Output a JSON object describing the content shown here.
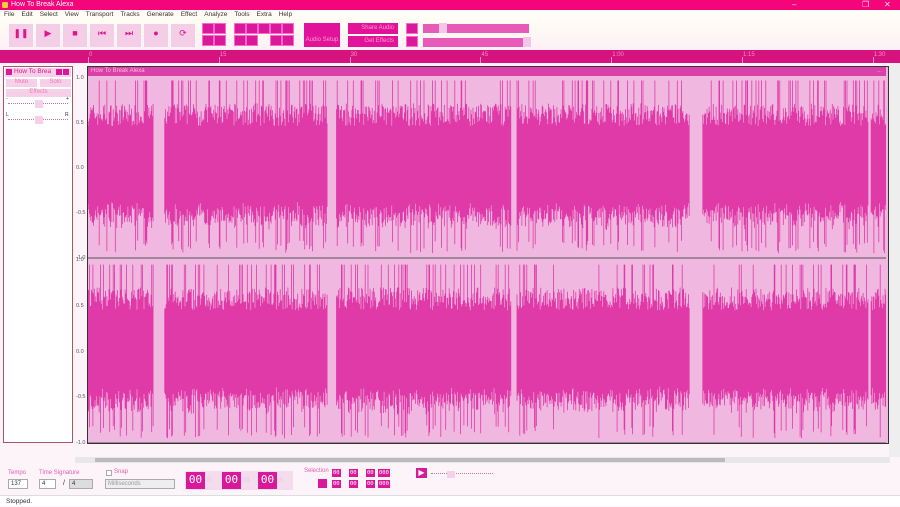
{
  "window": {
    "title": "How To Break Alexa",
    "minimize": "–",
    "restore": "❐",
    "close": "✕"
  },
  "menu": [
    "File",
    "Edit",
    "Select",
    "View",
    "Transport",
    "Tracks",
    "Generate",
    "Effect",
    "Analyze",
    "Tools",
    "Extra",
    "Help"
  ],
  "transport": [
    {
      "icon": "pause-icon",
      "glyph": "❚❚"
    },
    {
      "icon": "play-icon",
      "glyph": "▶"
    },
    {
      "icon": "stop-icon",
      "glyph": "■"
    },
    {
      "icon": "skip-start-icon",
      "glyph": "⏮"
    },
    {
      "icon": "skip-end-icon",
      "glyph": "⏭"
    },
    {
      "icon": "record-icon",
      "glyph": "●"
    },
    {
      "icon": "loop-icon",
      "glyph": "⟳"
    }
  ],
  "toolbar": {
    "audio_setup": "Audio Setup",
    "share_audio": "Share Audio",
    "get_effects": "Get Effects"
  },
  "ruler": {
    "ticks": [
      "0",
      "15",
      "30",
      "45",
      "1:00",
      "1:15",
      "1:30"
    ],
    "tick_seconds": [
      0,
      15,
      30,
      45,
      60,
      75,
      90
    ]
  },
  "track": {
    "name": "How To Brea",
    "full_name": "How To Break Alexa",
    "mute": "Mute",
    "solo": "Solo",
    "effects": "Effects",
    "gain_minus": "-",
    "gain_plus": "+",
    "pan_left": "L",
    "pan_right": "R",
    "menu": "..."
  },
  "yaxis": [
    "1.0",
    "0.5",
    "0.0",
    "-0.5",
    "-1.0"
  ],
  "audio_segments_seconds": [
    [
      0,
      7.5
    ],
    [
      8.8,
      27.5
    ],
    [
      28.5,
      48.5
    ],
    [
      49.2,
      69
    ],
    [
      70.5,
      89.5
    ],
    [
      89.8,
      91.5
    ]
  ],
  "colors": {
    "title": "#f5057c",
    "ruler": "#d6127f",
    "wave": "#e03aa8",
    "wave_bg": "#f0b8e0"
  },
  "bottom": {
    "tempo_label": "Tempo",
    "tempo": "137",
    "timesig_label": "Time Signature",
    "timesig_num": "4",
    "timesig_sep": "/",
    "timesig_den": "4",
    "snap_label": "Snap",
    "snap_unit": "Milliseconds",
    "time": [
      "00",
      "00",
      "00"
    ],
    "time_units": [
      "h",
      "m",
      "s"
    ],
    "selection_label": "Selection",
    "sel_start": [
      "00",
      "00",
      "00",
      "000"
    ],
    "sel_end": [
      "00",
      "00",
      "00",
      "000"
    ]
  },
  "status": "Stopped."
}
